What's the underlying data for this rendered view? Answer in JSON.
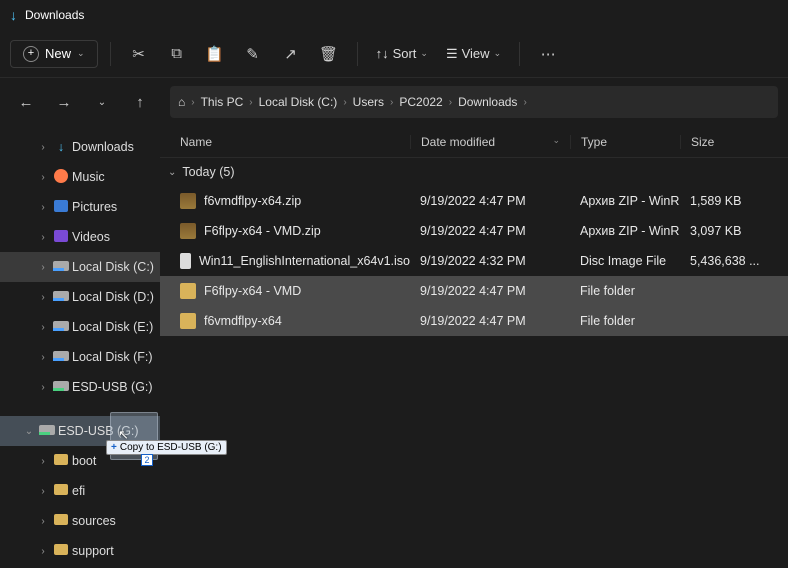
{
  "title": "Downloads",
  "toolbar": {
    "new_label": "New",
    "sort_label": "Sort",
    "view_label": "View"
  },
  "breadcrumb": [
    "This PC",
    "Local Disk (C:)",
    "Users",
    "PC2022",
    "Downloads"
  ],
  "sidebar": {
    "items": [
      {
        "label": "Downloads",
        "icon": "download",
        "indent": 1,
        "chev": ">"
      },
      {
        "label": "Music",
        "icon": "music",
        "indent": 1,
        "chev": ">"
      },
      {
        "label": "Pictures",
        "icon": "pictures",
        "indent": 1,
        "chev": ">"
      },
      {
        "label": "Videos",
        "icon": "videos",
        "indent": 1,
        "chev": ">"
      },
      {
        "label": "Local Disk (C:)",
        "icon": "disk",
        "indent": 1,
        "chev": ">",
        "sel": true
      },
      {
        "label": "Local Disk (D:)",
        "icon": "disk",
        "indent": 1,
        "chev": ">"
      },
      {
        "label": "Local Disk (E:)",
        "icon": "disk",
        "indent": 1,
        "chev": ">"
      },
      {
        "label": "Local Disk (F:)",
        "icon": "disk",
        "indent": 1,
        "chev": ">"
      },
      {
        "label": "ESD-USB (G:)",
        "icon": "usb",
        "indent": 1,
        "chev": ">"
      },
      {
        "label": "ESD-USB (G:)",
        "icon": "usb",
        "indent": 0,
        "chev": "v",
        "drop": true
      },
      {
        "label": "boot",
        "icon": "folder",
        "indent": 1,
        "chev": ">"
      },
      {
        "label": "efi",
        "icon": "folder",
        "indent": 1,
        "chev": ">"
      },
      {
        "label": "sources",
        "icon": "folder",
        "indent": 1,
        "chev": ">"
      },
      {
        "label": "support",
        "icon": "folder",
        "indent": 1,
        "chev": ">"
      }
    ]
  },
  "columns": {
    "name": "Name",
    "date": "Date modified",
    "type": "Type",
    "size": "Size"
  },
  "group": {
    "label": "Today (5)"
  },
  "files": [
    {
      "name": "f6vmdflpy-x64.zip",
      "date": "9/19/2022 4:47 PM",
      "type": "Архив ZIP - WinR...",
      "size": "1,589 KB",
      "icon": "zip",
      "sel": false
    },
    {
      "name": "F6flpy-x64 - VMD.zip",
      "date": "9/19/2022 4:47 PM",
      "type": "Архив ZIP - WinR...",
      "size": "3,097 KB",
      "icon": "zip",
      "sel": false
    },
    {
      "name": "Win11_EnglishInternational_x64v1.iso",
      "date": "9/19/2022 4:32 PM",
      "type": "Disc Image File",
      "size": "5,436,638 ...",
      "icon": "iso",
      "sel": false
    },
    {
      "name": "F6flpy-x64 - VMD",
      "date": "9/19/2022 4:47 PM",
      "type": "File folder",
      "size": "",
      "icon": "fold",
      "sel": true
    },
    {
      "name": "f6vmdflpy-x64",
      "date": "9/19/2022 4:47 PM",
      "type": "File folder",
      "size": "",
      "icon": "fold",
      "sel": true
    }
  ],
  "drag": {
    "tip": "Copy to ESD-USB (G:)",
    "count": "2"
  }
}
